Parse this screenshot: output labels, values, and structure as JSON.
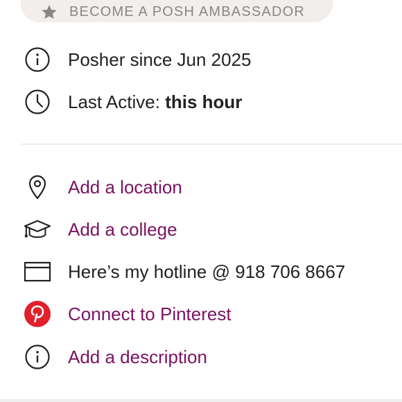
{
  "ambassador": {
    "label": "BECOME A POSH AMBASSADOR",
    "icon": "star-icon"
  },
  "info": {
    "since": "Posher since Jun 2025",
    "last_active_prefix": "Last Active: ",
    "last_active_value": "this hour"
  },
  "profile_actions": {
    "location": "Add a location",
    "college": "Add a college",
    "hotline": "Here’s my hotline @ 918 706 8667",
    "pinterest": "Connect to Pinterest",
    "description": "Add a description"
  },
  "colors": {
    "link": "#7b1262",
    "pinterest": "#e1202b",
    "text": "#222222",
    "pill": "#f1eeeb"
  }
}
